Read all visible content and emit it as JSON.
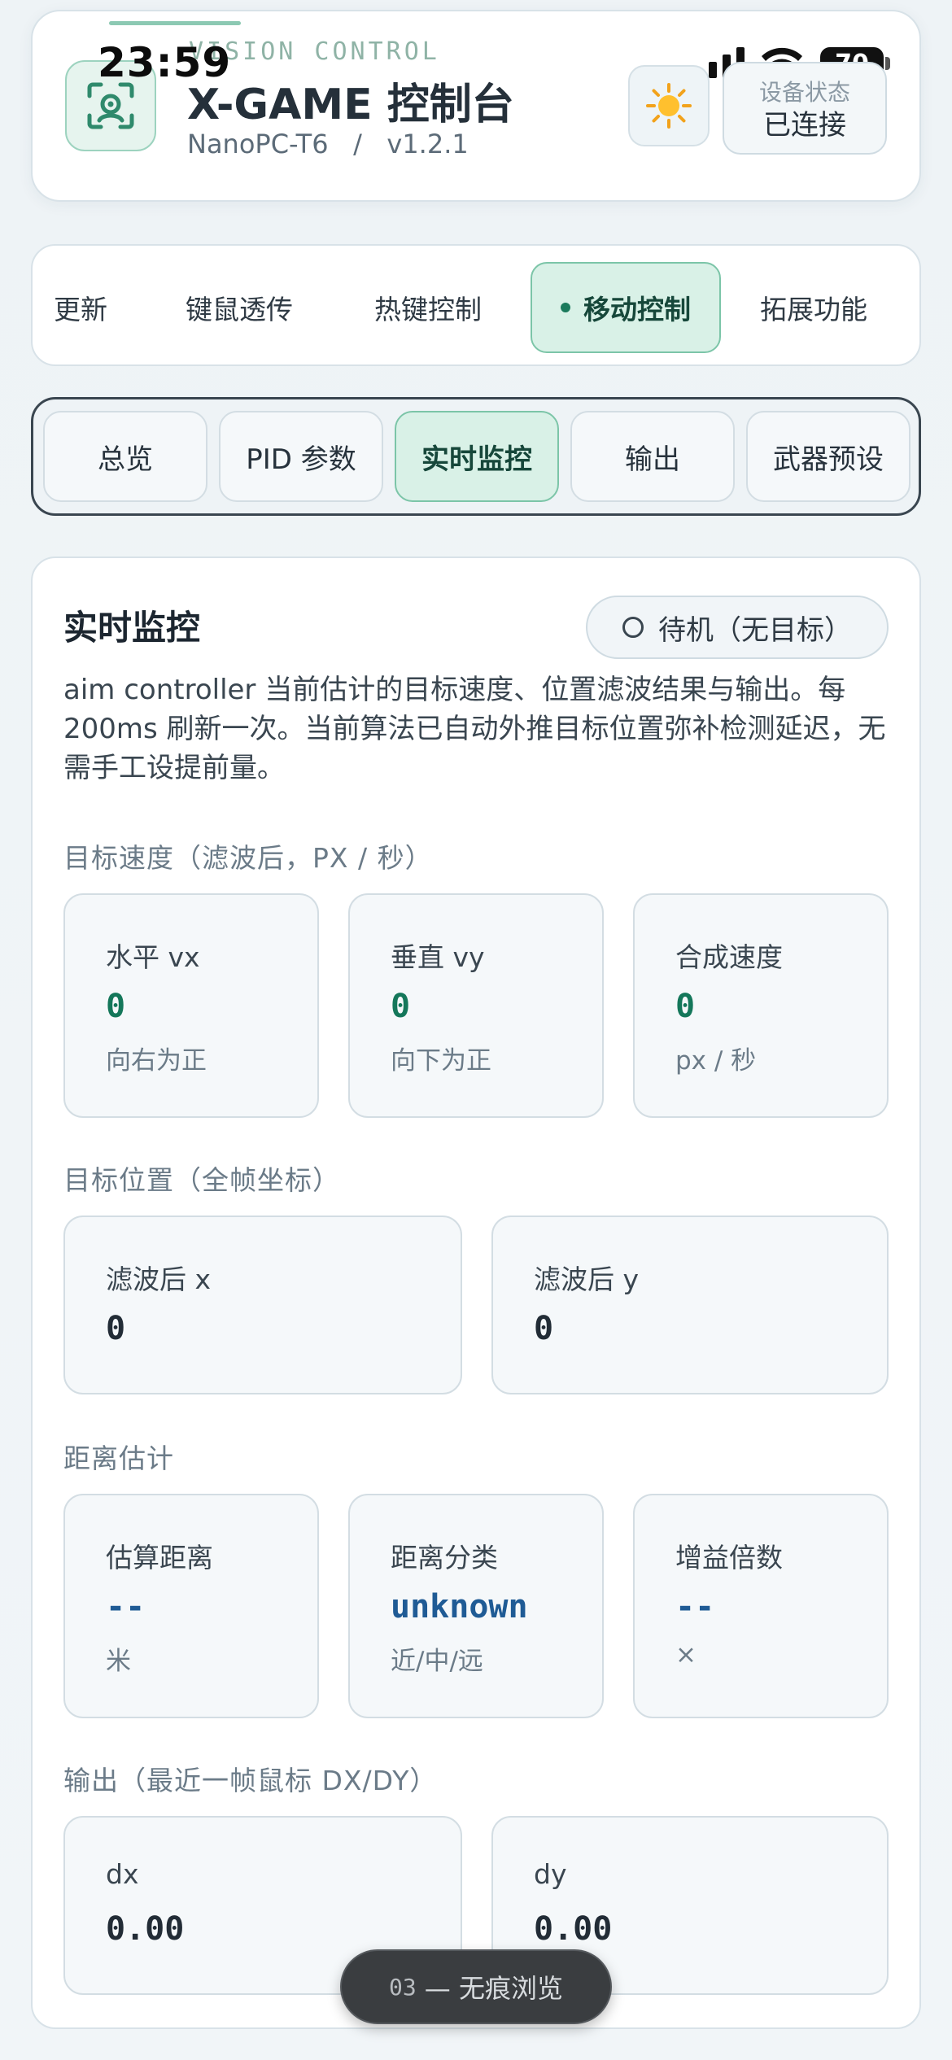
{
  "status_bar": {
    "time": "23:59",
    "battery": "70"
  },
  "header": {
    "kicker": "VISION CONTROL",
    "title": "X-GAME 控制台",
    "device": "NanoPC-T6",
    "separator": "/",
    "version": "v1.2.1",
    "theme_icon": "sun-icon",
    "device_status_label": "设备状态",
    "device_status_value": "已连接"
  },
  "tabs": [
    {
      "label": "更新"
    },
    {
      "label": "键鼠透传"
    },
    {
      "label": "热键控制"
    },
    {
      "label": "移动控制",
      "active": true
    },
    {
      "label": "拓展功能"
    }
  ],
  "subtabs": [
    {
      "label": "总览"
    },
    {
      "label": "PID 参数"
    },
    {
      "label": "实时监控",
      "active": true
    },
    {
      "label": "输出"
    },
    {
      "label": "武器预设"
    }
  ],
  "monitor": {
    "title": "实时监控",
    "state": "待机（无目标）",
    "description": "aim controller 当前估计的目标速度、位置滤波结果与输出。每 200ms 刷新一次。当前算法已自动外推目标位置弥补检测延迟，无需手工设提前量。",
    "velocity": {
      "label": "目标速度（滤波后，PX / 秒）",
      "items": [
        {
          "label": "水平 vx",
          "value": "0",
          "unit": "向右为正"
        },
        {
          "label": "垂直 vy",
          "value": "0",
          "unit": "向下为正"
        },
        {
          "label": "合成速度",
          "value": "0",
          "unit": "px / 秒"
        }
      ]
    },
    "position": {
      "label": "目标位置（全帧坐标）",
      "items": [
        {
          "label": "滤波后 x",
          "value": "0"
        },
        {
          "label": "滤波后 y",
          "value": "0"
        }
      ]
    },
    "distance": {
      "label": "距离估计",
      "items": [
        {
          "label": "估算距离",
          "value": "--",
          "unit": "米"
        },
        {
          "label": "距离分类",
          "value": "unknown",
          "unit": "近/中/远"
        },
        {
          "label": "增益倍数",
          "value": "--",
          "unit": "×"
        }
      ]
    },
    "output": {
      "label": "输出（最近一帧鼠标 DX/DY）",
      "items": [
        {
          "label": "dx",
          "value": "0.00"
        },
        {
          "label": "dy",
          "value": "0.00"
        }
      ]
    }
  },
  "overlay": {
    "code": "03",
    "text": "— 无痕浏览"
  },
  "colors": {
    "accent": "#14775a",
    "accent_bg": "#d9f1e7",
    "accent_border": "#7cc5a8",
    "blue_value": "#1f5b95"
  }
}
